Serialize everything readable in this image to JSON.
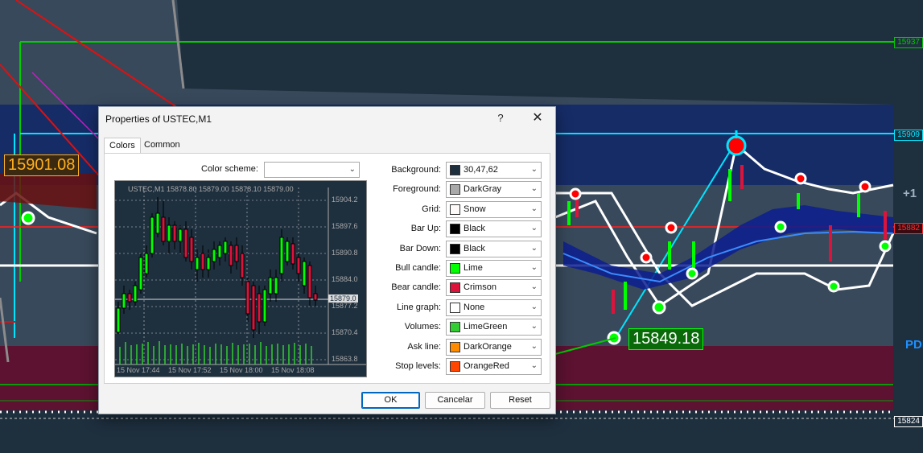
{
  "chart": {
    "left_price_label": "15901.08",
    "green_price_label": "15849.18",
    "right_edge_text_1": "+1",
    "right_edge_text_2": "PDI",
    "axis_labels": [
      {
        "text": "15937",
        "color": "#00c800"
      },
      {
        "text": "15909",
        "color": "#00e5ff"
      },
      {
        "text": "15882",
        "color": "#ff3030"
      },
      {
        "text": "15824",
        "color": "#ffffff"
      }
    ]
  },
  "dialog": {
    "title": "Properties of USTEC,M1",
    "help_label": "?",
    "close_label": "✕",
    "tabs": [
      {
        "label": "Colors"
      },
      {
        "label": "Common"
      }
    ],
    "color_scheme_label": "Color scheme:",
    "color_scheme_value": "",
    "preview": {
      "header": "USTEC,M1  15878.80 15879.00 15878.10 15879.00",
      "price_ticks": [
        "15904.2",
        "15897.6",
        "15890.8",
        "15884.0",
        "15877.2",
        "15870.4",
        "15863.8"
      ],
      "current_price": "15879.0",
      "time_ticks": [
        "15 Nov 17:44",
        "15 Nov 17:52",
        "15 Nov 18:00",
        "15 Nov 18:08"
      ]
    },
    "properties": [
      {
        "label": "Background:",
        "value": "30,47,62",
        "swatch": "#1e2f3e"
      },
      {
        "label": "Foreground:",
        "value": "DarkGray",
        "swatch": "#a9a9a9"
      },
      {
        "label": "Grid:",
        "value": "Snow",
        "swatch": "#fffafa"
      },
      {
        "label": "Bar Up:",
        "value": "Black",
        "swatch": "#000000"
      },
      {
        "label": "Bar Down:",
        "value": "Black",
        "swatch": "#000000"
      },
      {
        "label": "Bull candle:",
        "value": "Lime",
        "swatch": "#00ff00"
      },
      {
        "label": "Bear candle:",
        "value": "Crimson",
        "swatch": "#dc143c"
      },
      {
        "label": "Line graph:",
        "value": "None",
        "swatch": "#ffffff"
      },
      {
        "label": "Volumes:",
        "value": "LimeGreen",
        "swatch": "#32cd32"
      },
      {
        "label": "Ask line:",
        "value": "DarkOrange",
        "swatch": "#ff8c00"
      },
      {
        "label": "Stop levels:",
        "value": "OrangeRed",
        "swatch": "#ff4500"
      }
    ],
    "buttons": {
      "ok": "OK",
      "cancel": "Cancelar",
      "reset": "Reset"
    }
  }
}
